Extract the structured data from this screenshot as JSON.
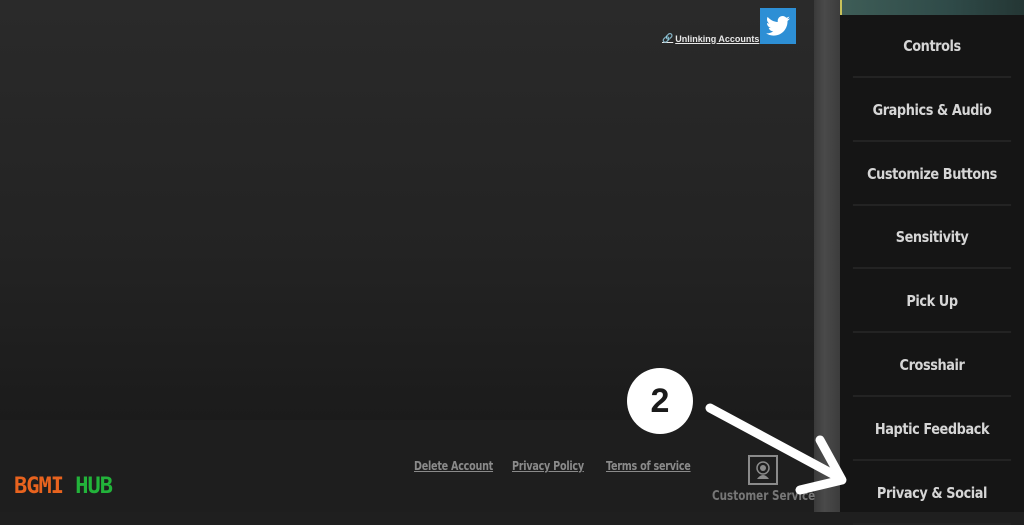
{
  "top_bar": {
    "unlink_label": "Unlinking Accounts",
    "social_icon": "twitter-icon"
  },
  "sidebar": {
    "items": [
      {
        "label": "Controls"
      },
      {
        "label": "Graphics & Audio"
      },
      {
        "label": "Customize Buttons"
      },
      {
        "label": "Sensitivity"
      },
      {
        "label": "Pick Up"
      },
      {
        "label": "Crosshair"
      },
      {
        "label": "Haptic Feedback"
      },
      {
        "label": "Privacy & Social"
      }
    ]
  },
  "footer": {
    "delete_account": "Delete Account",
    "privacy_policy": "Privacy Policy",
    "terms": "Terms of service",
    "customer_service": "Customer Service"
  },
  "annotation": {
    "step_number": "2"
  },
  "watermark": {
    "part1": "BGMI",
    "part2": "HUB",
    "color1": "#e8631e",
    "color2": "#22b33a"
  }
}
